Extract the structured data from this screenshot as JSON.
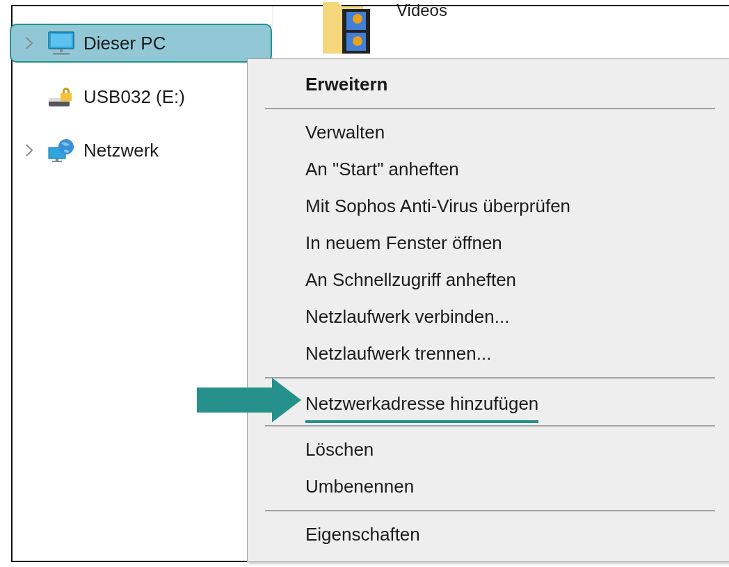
{
  "nav_pane": {
    "items": [
      {
        "label": "Dieser PC",
        "expandable": true,
        "selected": true
      },
      {
        "label": "USB032 (E:)",
        "expandable": false,
        "selected": false
      },
      {
        "label": "Netzwerk",
        "expandable": true,
        "selected": false
      }
    ]
  },
  "files": [
    {
      "label": "Videos"
    }
  ],
  "context_menu": {
    "items": [
      {
        "kind": "item",
        "label": "Erweitern",
        "bold": true,
        "highlighted": false
      },
      {
        "kind": "separator"
      },
      {
        "kind": "item",
        "label": "Verwalten",
        "bold": false,
        "highlighted": false
      },
      {
        "kind": "item",
        "label": "An \"Start\" anheften",
        "bold": false,
        "highlighted": false
      },
      {
        "kind": "item",
        "label": "Mit Sophos Anti-Virus überprüfen",
        "bold": false,
        "highlighted": false
      },
      {
        "kind": "item",
        "label": "In neuem Fenster öffnen",
        "bold": false,
        "highlighted": false
      },
      {
        "kind": "item",
        "label": "An Schnellzugriff anheften",
        "bold": false,
        "highlighted": false
      },
      {
        "kind": "item",
        "label": "Netzlaufwerk verbinden...",
        "bold": false,
        "highlighted": false
      },
      {
        "kind": "item",
        "label": "Netzlaufwerk trennen...",
        "bold": false,
        "highlighted": false
      },
      {
        "kind": "separator"
      },
      {
        "kind": "item",
        "label": "Netzwerkadresse hinzufügen",
        "bold": false,
        "highlighted": true
      },
      {
        "kind": "separator"
      },
      {
        "kind": "item",
        "label": "Löschen",
        "bold": false,
        "highlighted": false
      },
      {
        "kind": "item",
        "label": "Umbenennen",
        "bold": false,
        "highlighted": false
      },
      {
        "kind": "separator"
      },
      {
        "kind": "item",
        "label": "Eigenschaften",
        "bold": false,
        "highlighted": false
      }
    ]
  }
}
